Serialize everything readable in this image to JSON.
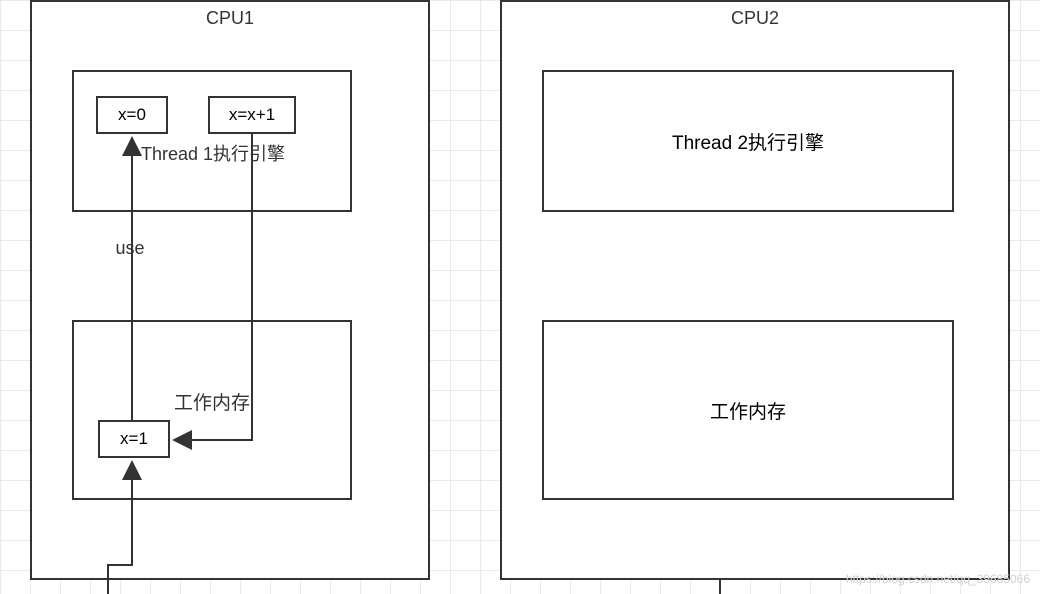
{
  "cpu1": {
    "title": "CPU1",
    "thread": {
      "label": "Thread 1执行引擎",
      "op1": "x=0",
      "op2": "x=x+1"
    },
    "memory": {
      "label": "工作内存",
      "cell": "x=1"
    },
    "arrowLabel": "use"
  },
  "cpu2": {
    "title": "CPU2",
    "thread": {
      "label": "Thread 2执行引擎"
    },
    "memory": {
      "label": "工作内存"
    }
  },
  "watermark": "https://blog.csdn.net/qq_39685066"
}
